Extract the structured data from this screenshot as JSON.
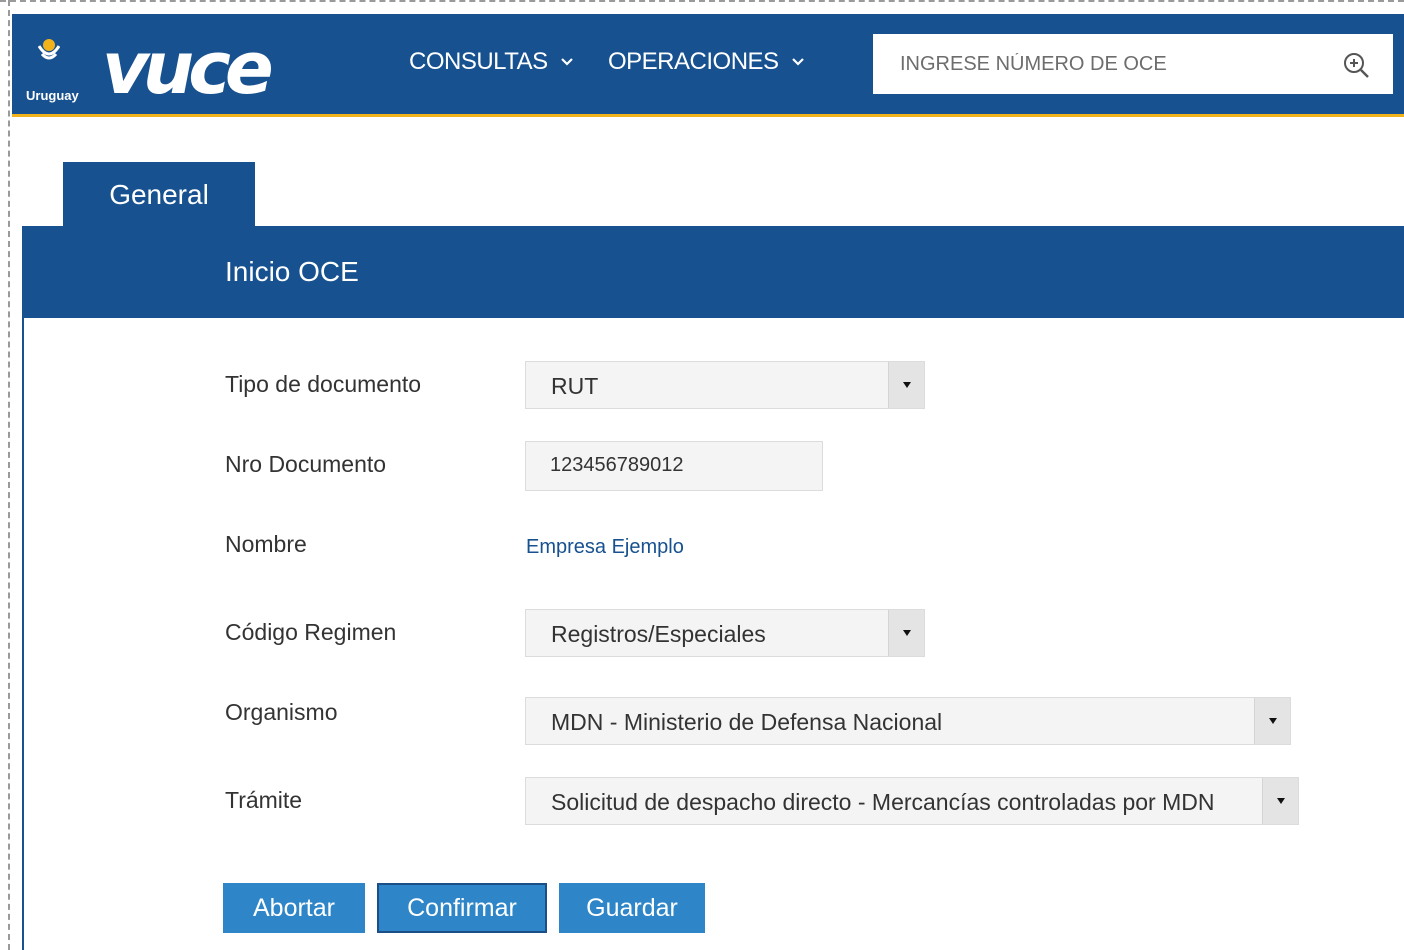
{
  "header": {
    "logo": {
      "text": "vuce",
      "country": "Uruguay"
    },
    "nav": [
      {
        "label": "CONSULTAS"
      },
      {
        "label": "OPERACIONES"
      }
    ],
    "search": {
      "placeholder": "INGRESE NÚMERO DE OCE",
      "value": ""
    }
  },
  "tabs": [
    {
      "label": "General",
      "active": true
    }
  ],
  "panel": {
    "title": "Inicio OCE"
  },
  "form": {
    "tipo_documento": {
      "label": "Tipo de documento",
      "value": "RUT"
    },
    "nro_documento": {
      "label": "Nro Documento",
      "value": "123456789012"
    },
    "nombre": {
      "label": "Nombre",
      "value": "Empresa Ejemplo"
    },
    "codigo_regimen": {
      "label": "Código Regimen",
      "value": "Registros/Especiales"
    },
    "organismo": {
      "label": "Organismo",
      "value": "MDN - Ministerio de Defensa Nacional"
    },
    "tramite": {
      "label": "Trámite",
      "value": "Solicitud de despacho directo - Mercancías controladas por MDN"
    }
  },
  "buttons": {
    "abortar": "Abortar",
    "confirmar": "Confirmar",
    "guardar": "Guardar"
  },
  "colors": {
    "primary": "#17518f",
    "accent": "#f2b21b",
    "button": "#2e86c8"
  }
}
